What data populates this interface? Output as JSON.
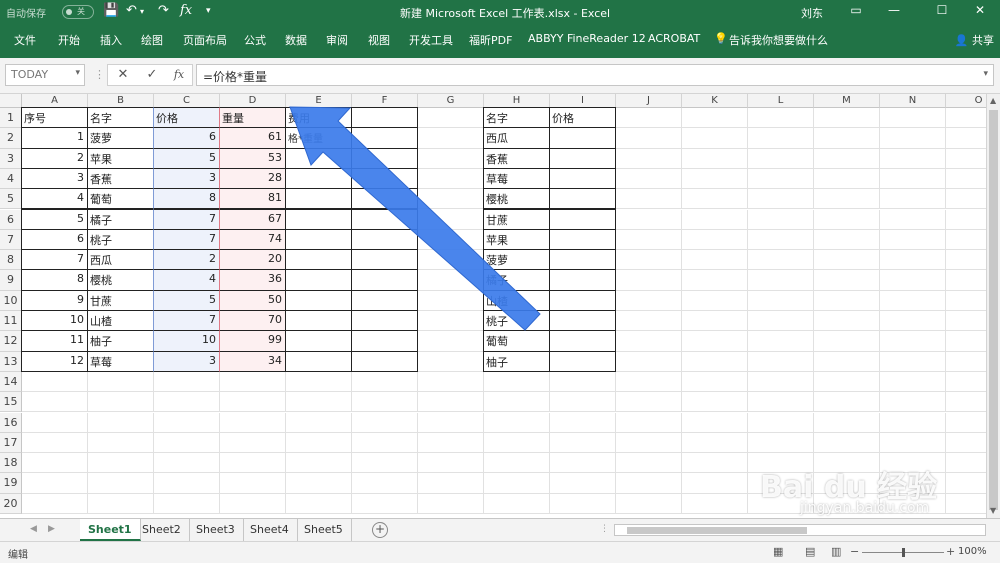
{
  "titlebar": {
    "autosave": "自动保存",
    "toggle": "关",
    "doc_title": "新建 Microsoft Excel 工作表.xlsx  -  Excel",
    "user": "刘东"
  },
  "ribbon": {
    "tabs": [
      "文件",
      "开始",
      "插入",
      "绘图",
      "页面布局",
      "公式",
      "数据",
      "审阅",
      "视图",
      "开发工具",
      "福昕PDF",
      "ABBYY FineReader 12",
      "ACROBAT",
      "告诉我你想要做什么"
    ],
    "share": "共享"
  },
  "formula_bar": {
    "name_box": "TODAY",
    "formula": "=价格*重量"
  },
  "columns": [
    "A",
    "B",
    "C",
    "D",
    "E",
    "F",
    "G",
    "H",
    "I",
    "J",
    "K",
    "L",
    "M",
    "N",
    "O"
  ],
  "rows": [
    "1",
    "2",
    "3",
    "4",
    "5",
    "6",
    "7",
    "8",
    "9",
    "10",
    "11",
    "12",
    "13",
    "14",
    "15",
    "16",
    "17",
    "18",
    "19",
    "20"
  ],
  "table1": {
    "headers": [
      "序号",
      "名字",
      "价格",
      "重量",
      "费用"
    ],
    "rows": [
      [
        "1",
        "菠萝",
        "6",
        "61"
      ],
      [
        "2",
        "苹果",
        "5",
        "53"
      ],
      [
        "3",
        "香蕉",
        "3",
        "28"
      ],
      [
        "4",
        "葡萄",
        "8",
        "81"
      ],
      [
        "5",
        "橘子",
        "7",
        "67"
      ],
      [
        "6",
        "桃子",
        "7",
        "74"
      ],
      [
        "7",
        "西瓜",
        "2",
        "20"
      ],
      [
        "8",
        "樱桃",
        "4",
        "36"
      ],
      [
        "9",
        "甘蔗",
        "5",
        "50"
      ],
      [
        "10",
        "山楂",
        "7",
        "70"
      ],
      [
        "11",
        "柚子",
        "10",
        "99"
      ],
      [
        "12",
        "草莓",
        "3",
        "34"
      ]
    ],
    "editing_cell": "格*重量"
  },
  "table2": {
    "headers": [
      "名字",
      "价格"
    ],
    "rows": [
      "西瓜",
      "香蕉",
      "草莓",
      "樱桃",
      "甘蔗",
      "苹果",
      "菠萝",
      "橘子",
      "山楂",
      "桃子",
      "葡萄",
      "柚子"
    ]
  },
  "sheets": [
    "Sheet1",
    "Sheet2",
    "Sheet3",
    "Sheet4",
    "Sheet5"
  ],
  "active_sheet": "Sheet1",
  "statusbar": {
    "mode": "编辑",
    "zoom": "100%"
  },
  "watermark": {
    "logo": "Bai du 经验",
    "url": "jingyan.baidu.com"
  },
  "colors": {
    "excel_green": "#217346",
    "arrow_blue": "#3b7bea"
  }
}
